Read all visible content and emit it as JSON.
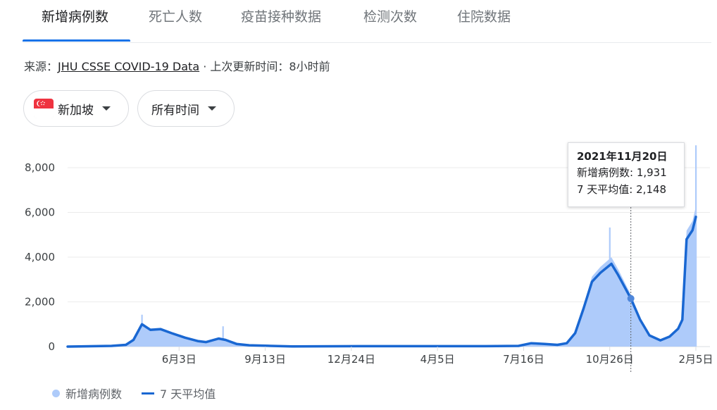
{
  "tabs": [
    {
      "label": "新增病例数",
      "active": true
    },
    {
      "label": "死亡人数"
    },
    {
      "label": "疫苗接种数据"
    },
    {
      "label": "检测次数"
    },
    {
      "label": "住院数据"
    }
  ],
  "source": {
    "prefix": "来源：",
    "link": "JHU CSSE COVID-19 Data",
    "sep": " · ",
    "updated_label": "上次更新时间：",
    "updated_value": "8小时前"
  },
  "filters": {
    "region": "新加坡",
    "time_range": "所有时间"
  },
  "tooltip": {
    "date": "2021年11月20日",
    "cases_label": "新增病例数: ",
    "cases_value": "1,931",
    "avg_label": "7 天平均值: ",
    "avg_value": "2,148"
  },
  "legend": {
    "cases": "新增病例数",
    "avg": "7 天平均值"
  },
  "colors": {
    "bars": "#aecbfa",
    "line": "#1967d2",
    "accent": "#1a73e8"
  },
  "chart_data": {
    "type": "area",
    "yticks": [
      0,
      2000,
      4000,
      6000,
      8000
    ],
    "ytick_labels": [
      "0",
      "2,000",
      "4,000",
      "6,000",
      "8,000"
    ],
    "ylim": [
      0,
      9500
    ],
    "xlabels": [
      "6月3日",
      "9月13日",
      "12月24日",
      "4月5日",
      "7月16日",
      "10月26日",
      "2月5日"
    ],
    "x_start": "2020-01-23",
    "x_end": "2022-02-05",
    "xlabel_dates": [
      "2020-06-03",
      "2020-09-13",
      "2020-12-24",
      "2021-04-05",
      "2021-07-16",
      "2021-10-26",
      "2022-02-05"
    ],
    "highlight_date": "2021-11-20",
    "series": [
      {
        "name": "7 天平均值",
        "points": [
          [
            "2020-01-23",
            0
          ],
          [
            "2020-03-15",
            30
          ],
          [
            "2020-04-01",
            80
          ],
          [
            "2020-04-10",
            300
          ],
          [
            "2020-04-20",
            1000
          ],
          [
            "2020-04-30",
            750
          ],
          [
            "2020-05-12",
            780
          ],
          [
            "2020-05-25",
            600
          ],
          [
            "2020-06-10",
            400
          ],
          [
            "2020-06-25",
            250
          ],
          [
            "2020-07-05",
            200
          ],
          [
            "2020-07-20",
            360
          ],
          [
            "2020-07-28",
            300
          ],
          [
            "2020-08-10",
            120
          ],
          [
            "2020-08-25",
            60
          ],
          [
            "2020-09-20",
            30
          ],
          [
            "2020-10-15",
            10
          ],
          [
            "2021-01-01",
            20
          ],
          [
            "2021-04-01",
            20
          ],
          [
            "2021-06-01",
            20
          ],
          [
            "2021-07-10",
            30
          ],
          [
            "2021-07-25",
            150
          ],
          [
            "2021-08-10",
            120
          ],
          [
            "2021-08-25",
            80
          ],
          [
            "2021-09-05",
            150
          ],
          [
            "2021-09-15",
            600
          ],
          [
            "2021-09-25",
            1700
          ],
          [
            "2021-10-05",
            2900
          ],
          [
            "2021-10-15",
            3300
          ],
          [
            "2021-10-28",
            3700
          ],
          [
            "2021-11-05",
            3200
          ],
          [
            "2021-11-20",
            2148
          ],
          [
            "2021-12-01",
            1200
          ],
          [
            "2021-12-12",
            500
          ],
          [
            "2021-12-25",
            280
          ],
          [
            "2022-01-05",
            450
          ],
          [
            "2022-01-15",
            800
          ],
          [
            "2022-01-20",
            1200
          ],
          [
            "2022-01-25",
            4800
          ],
          [
            "2022-02-01",
            5200
          ],
          [
            "2022-02-05",
            5800
          ]
        ]
      },
      {
        "name": "新增病例数",
        "peaks": [
          [
            "2020-04-20",
            1426
          ],
          [
            "2020-07-25",
            908
          ],
          [
            "2021-10-26",
            5324
          ],
          [
            "2021-11-20",
            1931
          ],
          [
            "2022-02-05",
            9000
          ]
        ]
      }
    ]
  }
}
